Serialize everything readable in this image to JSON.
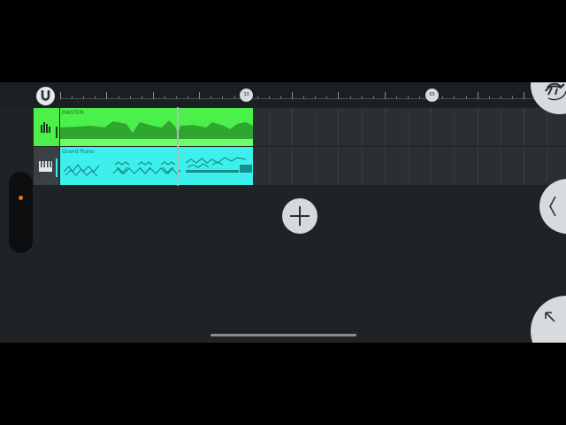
{
  "timeline": {
    "markers": [
      "33",
      "65"
    ]
  },
  "tracks": [
    {
      "name": "MASTER",
      "icon": "mixer-bars-icon",
      "color": "#4cf04a"
    },
    {
      "name": "Grand Piano",
      "icon": "piano-keys-icon",
      "color": "#3ef0ec"
    }
  ],
  "controls": {
    "add_icon": "plus-icon",
    "snap_icon": "magnet-icon",
    "top_right_icon": "bird-icon",
    "mid_right_icon": "chevron-left-icon",
    "bottom_right_icon": "arrow-up-left-icon"
  },
  "colors": {
    "background": "#1f2326",
    "master_clip": "#4cf04a",
    "piano_clip": "#3ef0ec",
    "indicator": "#e07a1f"
  }
}
